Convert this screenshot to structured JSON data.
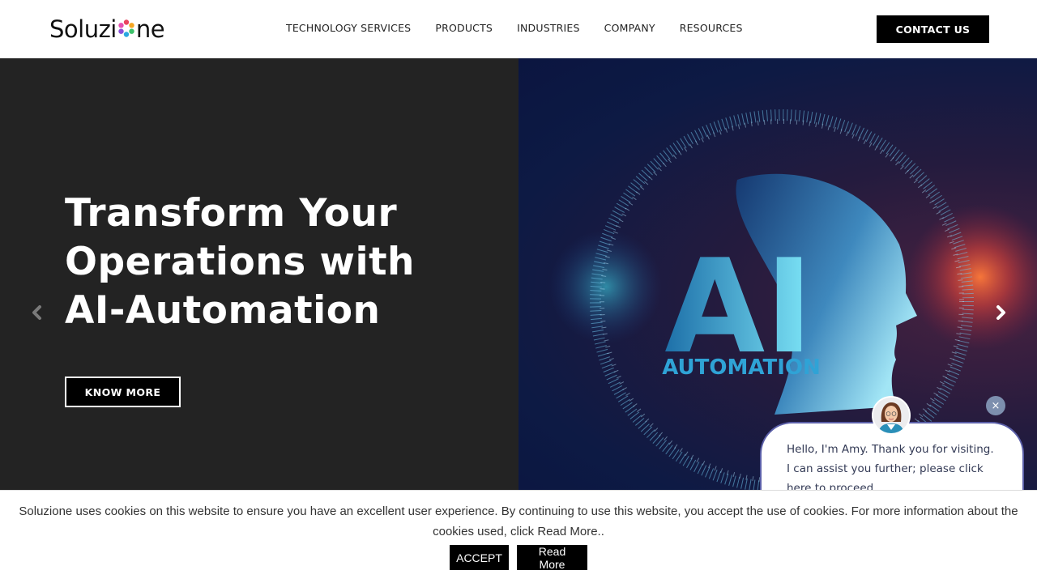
{
  "header": {
    "logo_text_before": "Soluzi",
    "logo_text_after": "ne",
    "logo_alt": "Soluzione",
    "nav": [
      {
        "label": "TECHNOLOGY SERVICES"
      },
      {
        "label": "PRODUCTS"
      },
      {
        "label": "INDUSTRIES"
      },
      {
        "label": "COMPANY"
      },
      {
        "label": "RESOURCES"
      }
    ],
    "contact_label": "CONTACT US"
  },
  "hero": {
    "title_lines": [
      "Transform Your",
      "Operations with",
      "AI-Automation"
    ],
    "cta_label": "KNOW MORE",
    "image": {
      "big_text": "AI",
      "sub_text": "AUTOMATION"
    },
    "prev_icon": "chevron-left-icon",
    "next_icon": "chevron-right-icon"
  },
  "chat": {
    "message": "Hello, I'm Amy. Thank you for visiting. I can assist you further; please click here to proceed.",
    "close_symbol": "×"
  },
  "cookie": {
    "text": "Soluzione uses cookies on this website to ensure you have an excellent user experience. By continuing to use this website, you accept the use of cookies. For more information about the cookies used, click Read More..",
    "accept_label": "ACCEPT",
    "read_more_label": "Read More"
  },
  "colors": {
    "hero_left_bg": "#232323",
    "button_bg": "#000000",
    "chat_border": "#5b5fa8",
    "chat_close_bg": "#7d8fae"
  }
}
